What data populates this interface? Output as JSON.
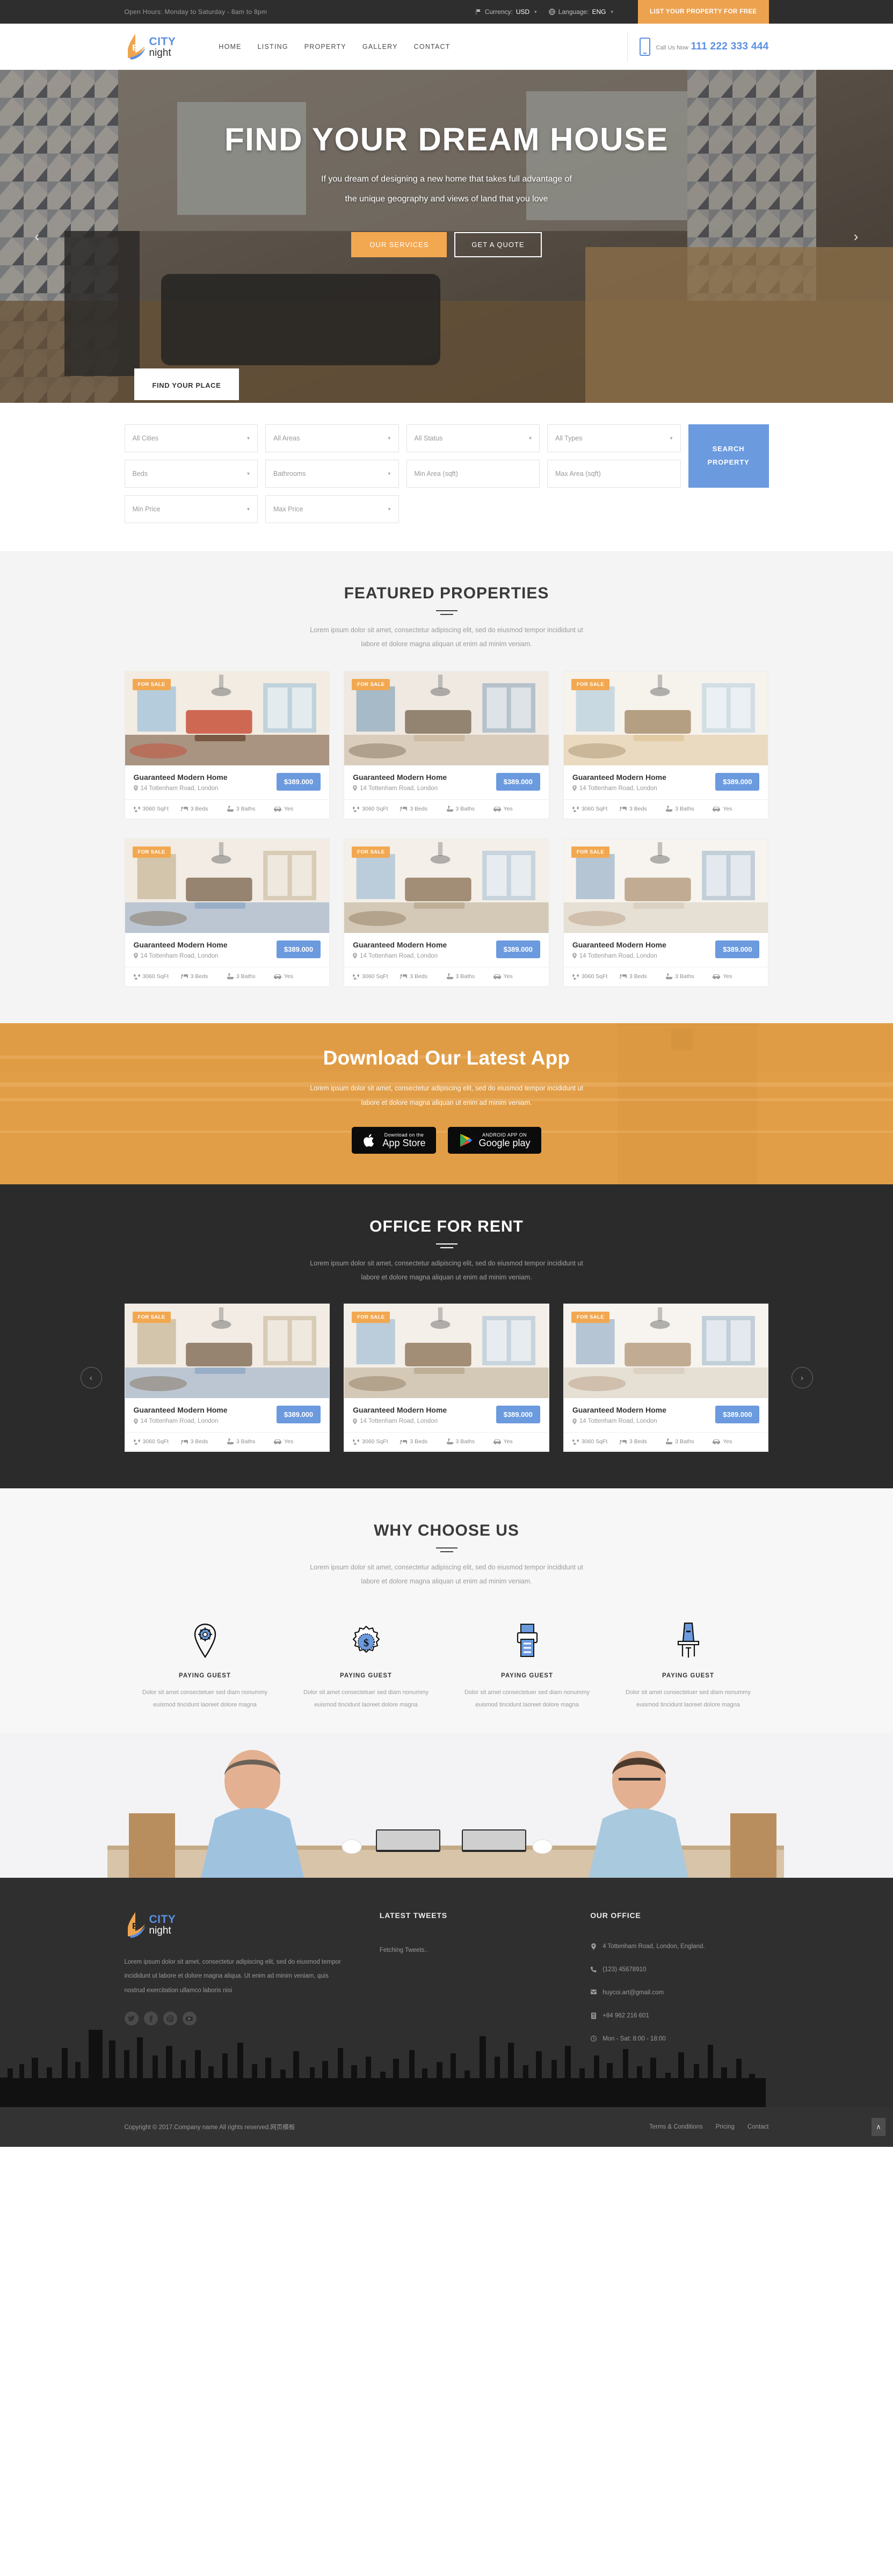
{
  "topbar": {
    "hours": "Open Hours: Monday to Saturday - 8am to 8pm",
    "currency_label": "Currency:",
    "currency_value": "USD",
    "language_label": "Language:",
    "language_value": "ENG",
    "cta": "LIST YOUR PROPERTY FOR FREE",
    "accent_color": "#eda24f"
  },
  "header": {
    "logo_top": "CITY",
    "logo_bottom": "night",
    "nav": [
      "HOME",
      "LISTING",
      "PROPERTY",
      "GALLERY",
      "CONTACT"
    ],
    "call_label": "Call Us Now",
    "call_number": "111 222 333 444",
    "brand_blue": "#5b8fe0"
  },
  "hero": {
    "title": "FIND YOUR DREAM HOUSE",
    "subtitle_line1": "If you dream of designing a new home that takes full advantage of",
    "subtitle_line2": "the unique geography and views of land that you love",
    "btn_primary": "OUR SERVICES",
    "btn_secondary": "GET A QUOTE",
    "prev": "‹",
    "next": "›"
  },
  "search": {
    "tab_label": "FIND YOUR PLACE",
    "fields": [
      {
        "label": "All Cities",
        "type": "select"
      },
      {
        "label": "All Areas",
        "type": "select"
      },
      {
        "label": "All Status",
        "type": "select"
      },
      {
        "label": "All Types",
        "type": "select"
      },
      {
        "label": "Beds",
        "type": "select"
      },
      {
        "label": "Bathrooms",
        "type": "select"
      },
      {
        "label": "Min Area (sqft)",
        "type": "text"
      },
      {
        "label": "Max Area (sqft)",
        "type": "text"
      },
      {
        "label": "Min Price",
        "type": "select"
      },
      {
        "label": "Max Price",
        "type": "select"
      }
    ],
    "button_line1": "SEARCH",
    "button_line2": "PROPERTY",
    "button_color": "#6b9ade"
  },
  "featured": {
    "title": "FEATURED PROPERTIES",
    "sub_line1": "Lorem ipsum dolor sit amet, consectetur adipiscing elit, sed do eiusmod tempor incididunt ut",
    "sub_line2": "labore et dolore magna aliquan ut enim ad minim veniam."
  },
  "property_card": {
    "badge": "FOR SALE",
    "title": "Guaranteed Modern Home",
    "address": "14 Tottenham Road, London",
    "price": "$389.000",
    "meta_area": "3060 SqFt",
    "meta_beds": "3 Beds",
    "meta_baths": "3 Baths",
    "meta_parking": "Yes"
  },
  "app": {
    "title": "Download Our Latest App",
    "sub_line1": "Lorem ipsum dolor sit amet, consectetur adipiscing elit, sed do eiusmod tempor incididunt ut",
    "sub_line2": "labore et dolore magna aliquan ut enim ad minim veniam.",
    "apple_small": "Download on the",
    "apple_big": "App Store",
    "google_small": "ANDROID APP ON",
    "google_big": "Google play"
  },
  "office": {
    "title": "OFFICE FOR RENT",
    "sub_line1": "Lorem ipsum dolor sit amet, consectetur adipiscing elit, sed do eiusmod tempor incididunt ut",
    "sub_line2": "labore et dolore magna aliquan ut enim ad minim veniam.",
    "prev": "‹",
    "next": "›"
  },
  "why": {
    "title": "WHY CHOOSE US",
    "sub_line1": "Lorem ipsum dolor sit amet, consectetur adipiscing elit, sed do eiusmod tempor incididunt ut",
    "sub_line2": "labore et dolore magna aliquan ut enim ad minim veniam.",
    "items": [
      {
        "icon": "map-pin-gear-icon",
        "title": "PAYING GUEST",
        "text": "Dolor sit amet consectetuer sed diam nonummy euismod tincidunt laoreet dolore magna"
      },
      {
        "icon": "dollar-badge-icon",
        "title": "PAYING GUEST",
        "text": "Dolor sit amet consectetuer sed diam nonummy euismod tincidunt laoreet dolore magna"
      },
      {
        "icon": "printer-icon",
        "title": "PAYING GUEST",
        "text": "Dolor sit amet consectetuer sed diam nonummy euismod tincidunt laoreet dolore magna"
      },
      {
        "icon": "podium-icon",
        "title": "PAYING GUEST",
        "text": "Dolor sit amet consectetuer sed diam nonummy euismod tincidunt laoreet dolore magna"
      }
    ]
  },
  "footer": {
    "logo_top": "CITY",
    "logo_bottom": "night",
    "about": "Lorem ipsum dolor sit amet, consectetur adipiscing elit, sed do eiusmod tempor incididunt ut labore et dolore magna aliqua. Ut enim ad minim veniam, quis nostrud exercitation ullamco laboris nisi",
    "socials": [
      "twitter-icon",
      "facebook-icon",
      "pinterest-icon",
      "youtube-icon"
    ],
    "tweets_title": "LATEST TWEETS",
    "tweets_body": "Fetching Tweets..",
    "office_title": "OUR OFFICE",
    "office_items": [
      {
        "icon": "location-icon",
        "text": "4 Tottenham Road, London, England."
      },
      {
        "icon": "phone-icon",
        "text": "(123) 45678910"
      },
      {
        "icon": "mail-icon",
        "text": "huycoi.art@gmail.com"
      },
      {
        "icon": "fax-icon",
        "text": "+84 962 216 601"
      },
      {
        "icon": "clock-icon",
        "text": "Mon - Sat: 8:00 - 18:00"
      }
    ],
    "copyright": "Copyright © 2017.Company name All rights reserved.网页模板",
    "links": [
      "Terms & Conditions",
      "Pricing",
      "Contact"
    ],
    "to_top": "∧"
  }
}
